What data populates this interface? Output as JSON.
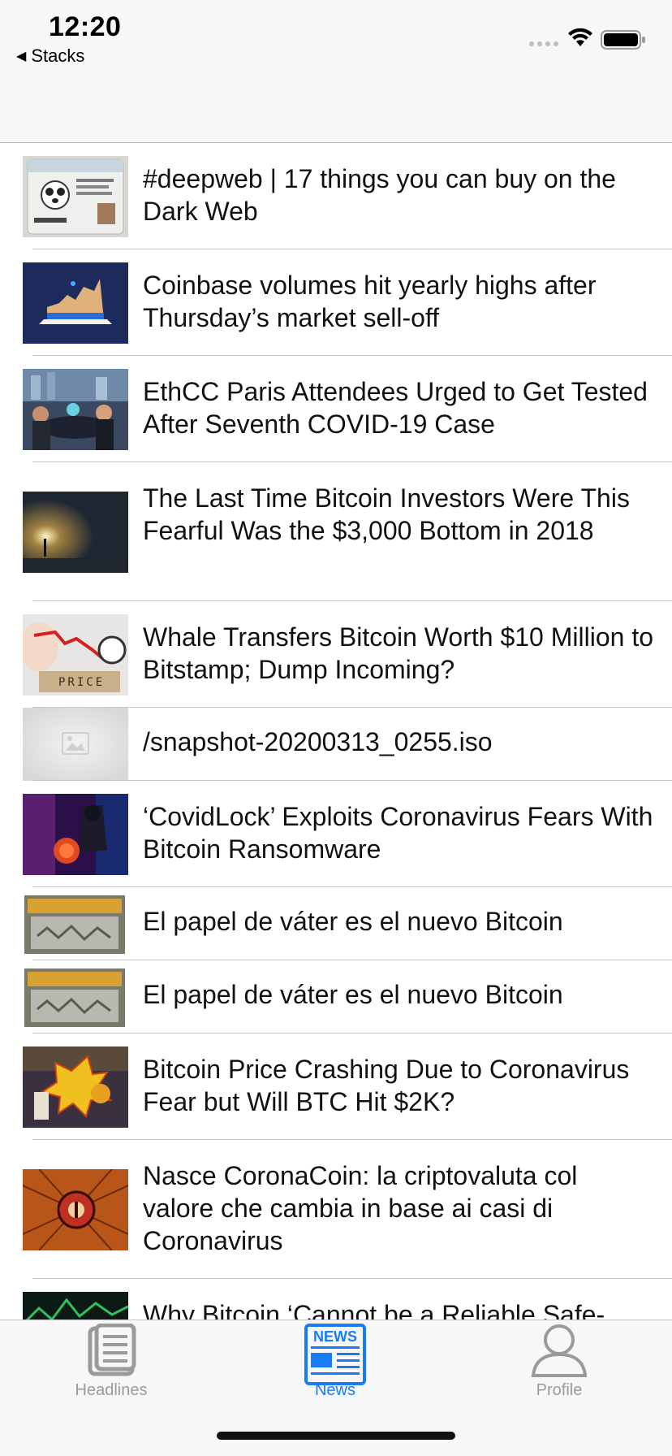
{
  "status_bar": {
    "time": "12:20",
    "back_label": "Stacks"
  },
  "articles": [
    {
      "title": "#deepweb | 17 things you can buy on the Dark Web",
      "thumb": "id-card-photo"
    },
    {
      "title": "Coinbase volumes hit yearly highs after Thursday’s market sell-off",
      "thumb": "chart-phone-photo"
    },
    {
      "title": "EthCC Paris Attendees Urged to Get Tested After Seventh COVID-19 Case",
      "thumb": "conference-photo"
    },
    {
      "title": "The Last Time Bitcoin Investors Were This Fearful Was the $3,000 Bottom in 2018",
      "thumb": "tunnel-light-photo"
    },
    {
      "title": "Whale Transfers Bitcoin Worth $10 Million to Bitstamp; Dump Incoming?",
      "thumb": "price-photo"
    },
    {
      "title": "/snapshot-20200313_0255.iso",
      "thumb": "placeholder-image-icon"
    },
    {
      "title": "‘CovidLock’ Exploits Coronavirus Fears With Bitcoin Ransomware",
      "thumb": "hacker-virus-photo"
    },
    {
      "title": "El papel de váter es el nuevo Bitcoin",
      "thumb": "store-shelf-photo"
    },
    {
      "title": "El papel de váter es el nuevo Bitcoin",
      "thumb": "store-shelf-photo"
    },
    {
      "title": "Bitcoin Price Crashing Due to Coronavirus Fear but Will BTC Hit $2K?",
      "thumb": "comic-bam-photo"
    },
    {
      "title": "Nasce CoronaCoin: la criptovaluta col valore che cambia in base ai casi di Coronavirus",
      "thumb": "virus-coin-photo"
    },
    {
      "title": "Why Bitcoin ‘Cannot be a Reliable Safe-",
      "thumb": "green-chart-photo"
    }
  ],
  "tabbar": {
    "tabs": [
      {
        "label": "Headlines",
        "icon": "document-icon",
        "active": false
      },
      {
        "label": "News",
        "icon": "newspaper-icon",
        "active": true
      },
      {
        "label": "Profile",
        "icon": "person-icon",
        "active": false
      }
    ]
  },
  "colors": {
    "accent": "#1a7cf5",
    "inactive": "#9a9a9a",
    "bar_bg": "#f7f7f7"
  }
}
